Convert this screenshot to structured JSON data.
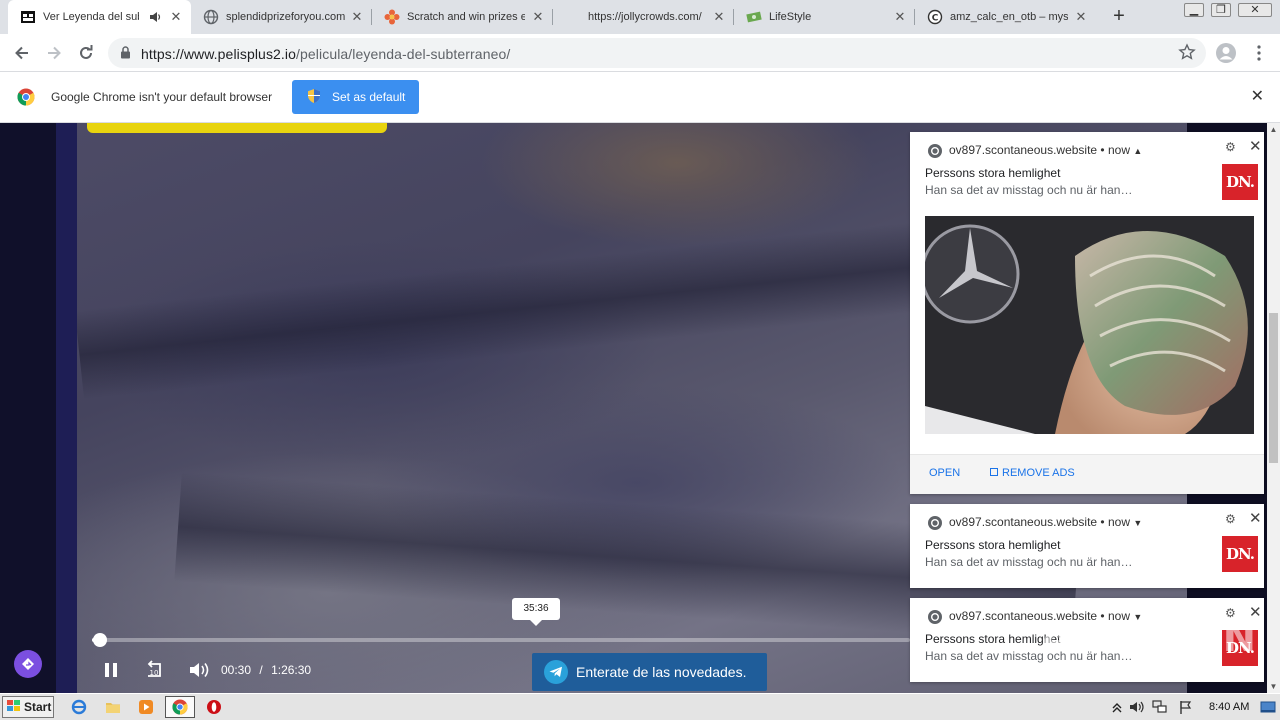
{
  "tabs": [
    {
      "title": "Ver Leyenda del sub",
      "active": true,
      "audio": true
    },
    {
      "title": "splendidprizeforyou.com"
    },
    {
      "title": "Scratch and win prizes e"
    },
    {
      "title": "https://jollycrowds.com/"
    },
    {
      "title": "LifeStyle"
    },
    {
      "title": "amz_calc_en_otb – mysi"
    }
  ],
  "toolbar": {
    "url_domain": "https://www.pelisplus2.io",
    "url_path": "/pelicula/leyenda-del-subterraneo/"
  },
  "infobar": {
    "message": "Google Chrome isn't your default browser",
    "button_label": "Set as default"
  },
  "player": {
    "tooltip_time": "35:36",
    "current_time": "00:30",
    "separator": "/",
    "duration": "1:26:30",
    "rewind_label": "10",
    "progress_fraction": 0.006
  },
  "telegram_banner": "Enterate de las novedades.",
  "notifications": [
    {
      "source": "ov897.scontaneous.website • now",
      "title": "Perssons stora hemlighet",
      "body": "Han sa det av misstag och nu är han…",
      "logo": "DN.",
      "expanded": true,
      "open_label": "OPEN",
      "remove_label": "REMOVE ADS"
    },
    {
      "source": "ov897.scontaneous.website • now",
      "title": "Perssons stora hemlighet",
      "body": "Han sa det av misstag och nu är han…",
      "logo": "DN."
    },
    {
      "source": "ov897.scontaneous.website • now",
      "title": "Perssons stora hemlighet",
      "body": "Han sa det av misstag och nu är han…",
      "logo": "DN."
    }
  ],
  "watermark": "ANY RUN",
  "taskbar": {
    "start_label": "Start",
    "clock": "8:40 AM"
  },
  "colors": {
    "infobar_button": "#3b8ff0",
    "telegram_banner": "#1f5d9a",
    "dn_logo": "#d8232a",
    "link": "#1a73e8"
  }
}
